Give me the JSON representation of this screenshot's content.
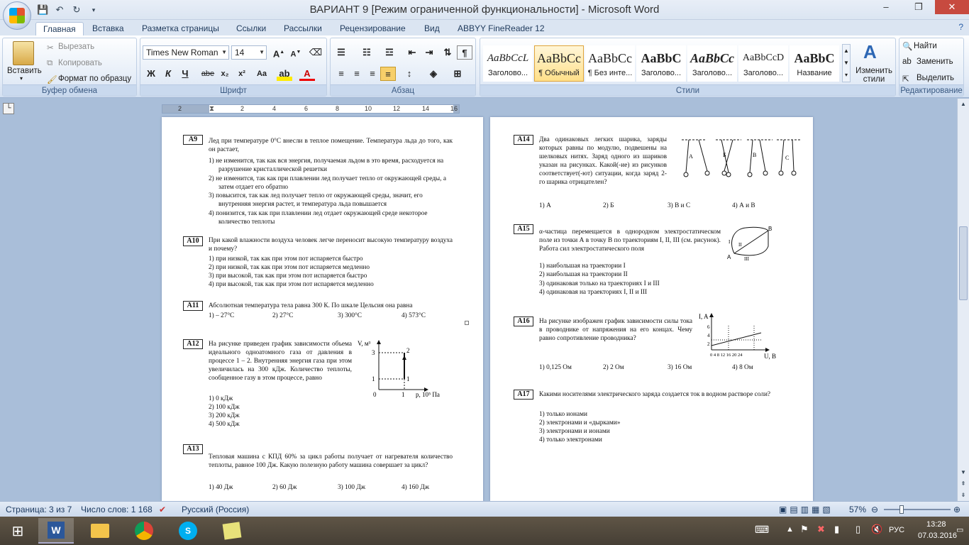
{
  "window": {
    "title": "ВАРИАНТ 9 [Режим ограниченной функциональности] - Microsoft Word"
  },
  "tabs": [
    "Главная",
    "Вставка",
    "Разметка страницы",
    "Ссылки",
    "Рассылки",
    "Рецензирование",
    "Вид",
    "ABBYY FineReader 12"
  ],
  "ribbon": {
    "clipboard": {
      "paste": "Вставить",
      "cut": "Вырезать",
      "copy": "Копировать",
      "format_painter": "Формат по образцу",
      "label": "Буфер обмена"
    },
    "font": {
      "name": "Times New Roman",
      "size": "14",
      "label": "Шрифт",
      "bold": "Ж",
      "italic": "К",
      "underline": "Ч",
      "strike": "abe",
      "sub": "x₂",
      "sup": "x²",
      "case": "Aa"
    },
    "paragraph": {
      "label": "Абзац"
    },
    "styles": {
      "label": "Стили",
      "items": [
        {
          "sample": "AaBbCcL",
          "name": "Заголово..."
        },
        {
          "sample": "AaBbCc",
          "name": "¶ Обычный"
        },
        {
          "sample": "AaBbCc",
          "name": "¶ Без инте..."
        },
        {
          "sample": "AaBbC",
          "name": "Заголово..."
        },
        {
          "sample": "AaBbCc",
          "name": "Заголово..."
        },
        {
          "sample": "AaBbCcD",
          "name": "Заголово..."
        },
        {
          "sample": "AaBbC",
          "name": "Название"
        }
      ],
      "change": "Изменить стили"
    },
    "editing": {
      "find": "Найти",
      "replace": "Заменить",
      "select": "Выделить",
      "label": "Редактирование"
    }
  },
  "ruler": {
    "numbers": [
      "2",
      "1",
      "2",
      "4",
      "6",
      "8",
      "10",
      "12",
      "14",
      "16"
    ]
  },
  "page_left": {
    "A9": {
      "label": "A9",
      "text": "Лед при температуре 0°С внесли в теплое помещение. Температура льда до того, как он растает,",
      "options": [
        "1)  не изменится, так как вся энергия, получаемая льдом в это время, расходуется на разрушение кристаллической решетки",
        "2)  не изменится, так как при плавлении лед получает тепло от окружающей среды, а затем отдает его обратно",
        "3)  повысится, так как лед получает тепло от окружающей среды, значит, его внутренняя энергия растет, и температура льда повышается",
        "4)  понизится, так как при плавлении лед отдает окружающей среде некоторое количество теплоты"
      ]
    },
    "A10": {
      "label": "A10",
      "text": "При какой влажности воздуха человек легче переносит высокую температуру воздуха и почему?",
      "options": [
        "1)  при низкой, так как при этом пот испаряется быстро",
        "2)  при низкой, так как при этом пот испаряется медленно",
        "3)  при высокой, так как при этом пот испаряется быстро",
        "4)  при высокой, так как при этом пот испаряется медленно"
      ]
    },
    "A11": {
      "label": "A11",
      "text": "Абсолютная температура тела равна 300 К. По шкале Цельсия она равна",
      "options": [
        "1)  – 27°С",
        "2)  27°С",
        "3)  300°С",
        "4)  573°С"
      ]
    },
    "A12": {
      "label": "A12",
      "text": "На рисунке приведен график зависимости объема идеального одноатомного газа от давления в процессе 1 – 2. Внутренняя энергия газа при этом увеличилась на 300 кДж. Количество теплоты, сообщенное газу в этом процессе, равно",
      "options": [
        "1)  0 кДж",
        "2)  100 кДж",
        "3)  200 кДж",
        "4)  500 кДж"
      ],
      "graph": {
        "ylabel": "V, м³",
        "xlabel": "p, 10⁵ Па",
        "y3": "3",
        "y1": "1",
        "x0": "0",
        "x1": "1",
        "p2": "2",
        "p1": "1"
      }
    },
    "A13": {
      "label": "A13",
      "text": "Тепловая машина с КПД 60% за цикл работы получает от нагревателя количество теплоты, равное 100 Дж. Какую полезную работу машина совершает за цикл?",
      "options": [
        "1)  40 Дж",
        "2)  60 Дж",
        "3)  100 Дж",
        "4)  160 Дж"
      ]
    }
  },
  "page_right": {
    "A14": {
      "label": "A14",
      "text": "Два одинаковых легких шарика, заряды которых равны по модулю, подвешены на шелковых нитях. Заряд одного из шариков указан на рисунках. Какой(-ие) из рисунков соответствует(-ют) ситуации, когда заряд 2-го шарика отрицателен?",
      "options": [
        "1)  А",
        "2)  Б",
        "3)  В и С",
        "4)  А и В"
      ],
      "fig": {
        "a": "А",
        "b": "Б",
        "c": "В",
        "d": "С"
      }
    },
    "A15": {
      "label": "A15",
      "text": "α-частица перемещается в однородном электростатическом поле из точки А в точку В по траекториям I, II, III (см. рисунок). Работа сил электростатического поля",
      "options": [
        "1)  наибольшая на траектории I",
        "2)  наибольшая на траектории II",
        "3)  одинаковая только на траекториях I  и III",
        "4)  одинаковая на траекториях I, II и III"
      ],
      "fig": {
        "A": "A",
        "B": "B",
        "I": "I",
        "II": "II",
        "III": "III"
      }
    },
    "A16": {
      "label": "A16",
      "text": "На рисунке изображен график зависимости силы тока в проводнике от напряжения на его концах. Чему равно сопротивление проводника?",
      "options": [
        "1)  0,125 Ом",
        "2)  2 Ом",
        "3)  16 Ом",
        "4)  8 Ом"
      ],
      "graph": {
        "ylabel": "I, A",
        "xlabel": "U, В",
        "yticks": [
          "6",
          "4",
          "2"
        ],
        "xticks": "0  4  8 12 16 20 24"
      }
    },
    "A17": {
      "label": "A17",
      "text": "Какими носителями электрического заряда создается ток в водном растворе соли?",
      "options": [
        "1)  только ионами",
        "2)  электронами и «дырками»",
        "3)  электронами и ионами",
        "4)  только электронами"
      ]
    }
  },
  "status": {
    "page": "Страница: 3 из 7",
    "words": "Число слов: 1 168",
    "lang": "Русский (Россия)",
    "zoom": "57%"
  },
  "taskbar": {
    "lang": "РУС",
    "time": "13:28",
    "date": "07.03.2016"
  }
}
